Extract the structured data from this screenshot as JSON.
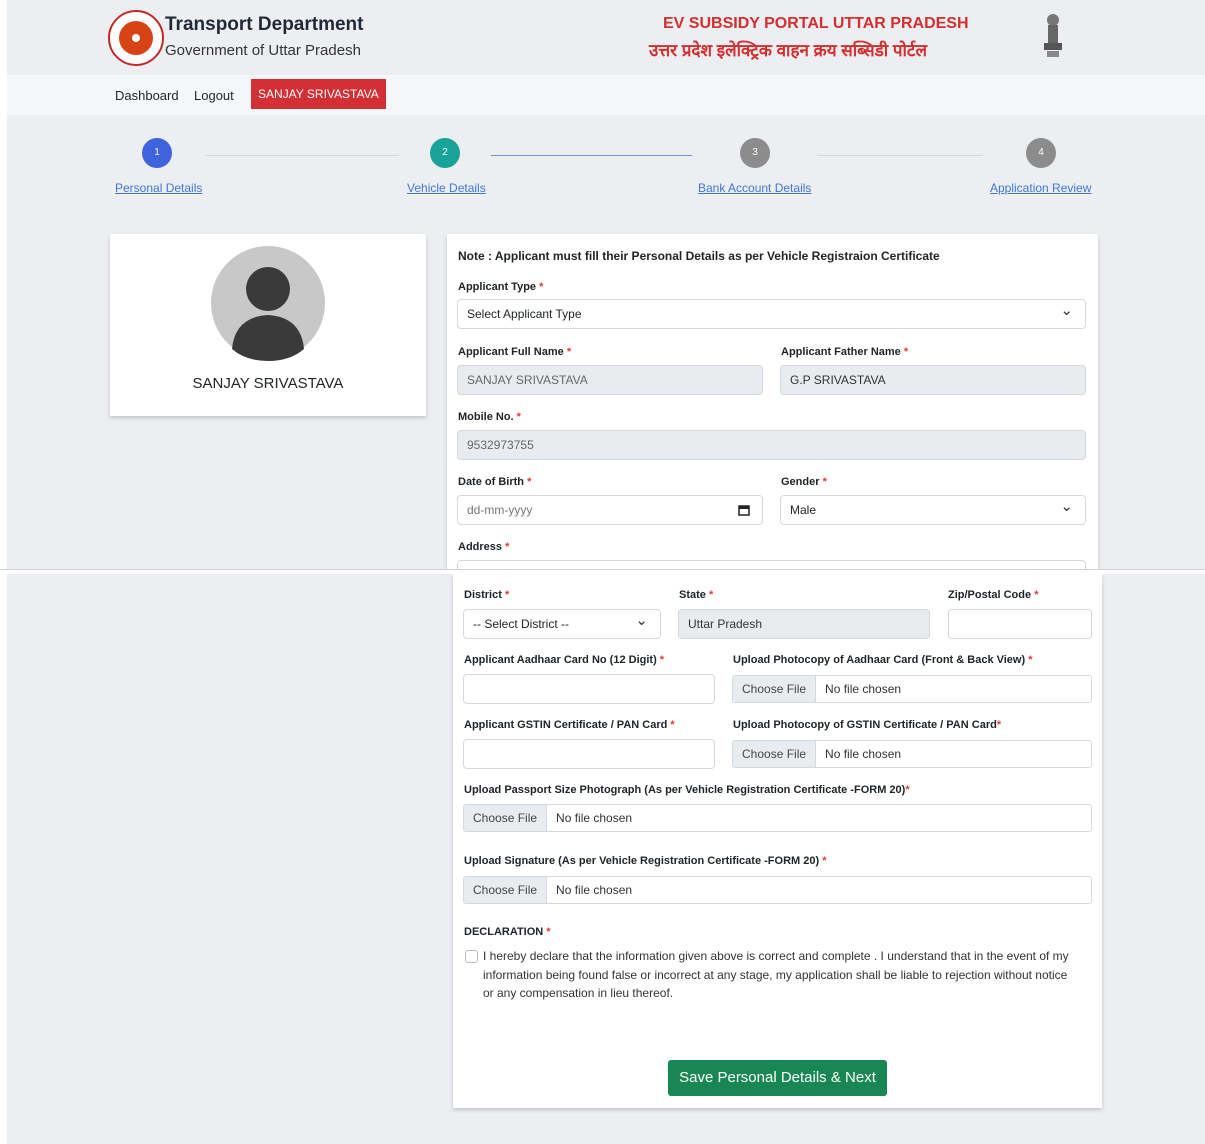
{
  "header": {
    "brand_title": "Transport Department",
    "brand_subtitle": "Government of Uttar Pradesh",
    "portal_title_en": "EV SUBSIDY PORTAL UTTAR PRADESH",
    "portal_title_hi": "उत्तर प्रदेश इलेक्ट्रिक वाहन क्रय सब्सिडी पोर्टल"
  },
  "nav": {
    "dashboard": "Dashboard",
    "logout": "Logout",
    "user": "SANJAY SRIVASTAVA"
  },
  "steps": [
    {
      "number": "1",
      "label": "Personal Details",
      "color": "#3e63dd"
    },
    {
      "number": "2",
      "label": "Vehicle Details",
      "color": "#17a398"
    },
    {
      "number": "3",
      "label": "Bank Account Details",
      "color": "#8c8c8c"
    },
    {
      "number": "4",
      "label": "Application Review",
      "color": "#8c8c8c"
    }
  ],
  "profile": {
    "name": "SANJAY SRIVASTAVA"
  },
  "form": {
    "note": "Note : Applicant must fill their Personal Details as per Vehicle Registraion Certificate",
    "applicant_type_label": "Applicant Type",
    "applicant_type_value": "Select Applicant Type",
    "full_name_label": "Applicant Full Name",
    "full_name_value": "SANJAY SRIVASTAVA",
    "father_name_label": "Applicant Father Name",
    "father_name_value": "G.P SRIVASTAVA",
    "mobile_label": "Mobile No.",
    "mobile_value": "9532973755",
    "dob_label": "Date of Birth",
    "dob_placeholder": "dd-mm-yyyy",
    "gender_label": "Gender",
    "gender_value": "Male",
    "address_label": "Address",
    "district_label": "District",
    "district_value": "-- Select District --",
    "state_label": "State",
    "state_value": "Uttar Pradesh",
    "zip_label": "Zip/Postal Code",
    "aadhaar_label": "Applicant Aadhaar Card No (12 Digit)",
    "aadhaar_upload_label": "Upload Photocopy of Aadhaar Card (Front & Back View)",
    "gstin_label": "Applicant GSTIN Certificate / PAN Card",
    "gstin_upload_label": "Upload Photocopy of GSTIN Certificate / PAN Card",
    "passport_label": "Upload Passport Size Photograph (As per Vehicle Registration Certificate -FORM 20)",
    "signature_label": "Upload Signature (As per Vehicle Registration Certificate -FORM 20)",
    "choose_file": "Choose File",
    "no_file": "No file chosen",
    "declaration_label": "DECLARATION",
    "declaration_line1": "I hereby declare that the information given above is correct and complete . I understand that in the event of my",
    "declaration_line2": "information being found false or incorrect at any stage, my application shall be liable to rejection without notice",
    "declaration_line3": "or any compensation in lieu thereof.",
    "submit_label": "Save Personal Details & Next"
  },
  "required_mark": "*",
  "calendar_icon": "calendar-icon"
}
